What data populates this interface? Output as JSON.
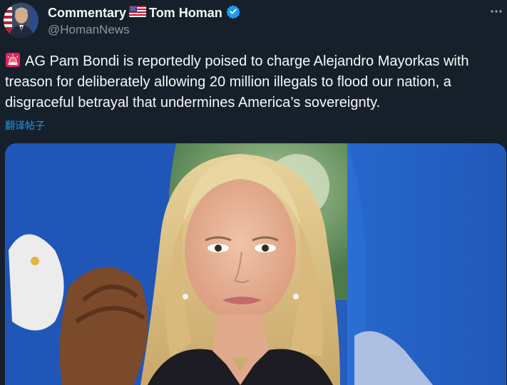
{
  "header": {
    "prefix": "Commentary",
    "name": "Tom Homan",
    "handle": "@HomanNews"
  },
  "tweet": {
    "emoji": "siren",
    "text": "AG Pam Bondi is reportedly poised to charge Alejandro Mayorkas with treason for deliberately allowing 20 million illegals to flood our nation, a disgraceful betrayal that undermines America’s sovereignty.",
    "translate_label": "翻译帖子"
  },
  "icons": {
    "flag": "us-flag-icon",
    "verified": "verified-badge-icon",
    "more": "more-options-icon",
    "siren": "police-siren-icon"
  },
  "colors": {
    "background": "#15202b",
    "text": "#f7f9f9",
    "muted": "#8b98a5",
    "accent": "#1d9bf0"
  }
}
